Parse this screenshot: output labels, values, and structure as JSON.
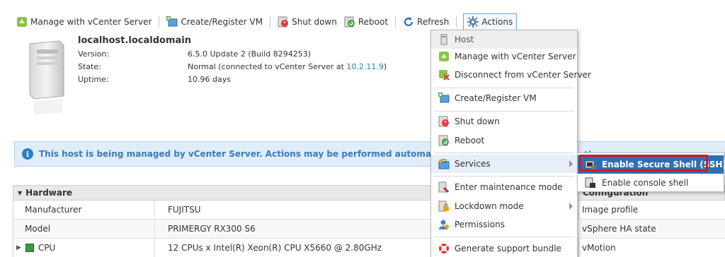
{
  "toolbar": {
    "manage": "Manage with vCenter Server",
    "create": "Create/Register VM",
    "shutdown": "Shut down",
    "reboot": "Reboot",
    "refresh": "Refresh",
    "actions": "Actions"
  },
  "host": {
    "name": "localhost.localdomain",
    "version_label": "Version:",
    "version_value": "6.5.0 Update 2 (Build 8294253)",
    "state_label": "State:",
    "state_value": "Normal (connected to vCenter Server at ",
    "state_ip": "10.2.11.9",
    "state_close": ")",
    "uptime_label": "Uptime:",
    "uptime_value": "10.96 days"
  },
  "banner": {
    "text": "This host is being managed by vCenter Server. Actions may be performed automatically by vCenter S"
  },
  "config_behind": "ctions",
  "hardware": {
    "title": "Hardware",
    "rows": [
      {
        "label": "Manufacturer",
        "value": "FUJITSU"
      },
      {
        "label": "Model",
        "value": "PRIMERGY RX300 S6"
      },
      {
        "label": "CPU",
        "value": "12 CPUs x Intel(R) Xeon(R) CPU X5660 @ 2.80GHz"
      }
    ]
  },
  "configuration": {
    "title": "Configuration",
    "rows": [
      "Image profile",
      "vSphere HA state",
      "vMotion"
    ]
  },
  "menu": {
    "header": "Host",
    "items": [
      "Manage with vCenter Server",
      "Disconnect from vCenter Server",
      "Create/Register VM",
      "Shut down",
      "Reboot",
      "Services",
      "Enter maintenance mode",
      "Lockdown mode",
      "Permissions",
      "Generate support bundle"
    ]
  },
  "submenu": {
    "items": [
      "Enable Secure Shell (SSH)",
      "Enable console shell"
    ]
  },
  "colors": {
    "accent": "#2e6fb0",
    "highlight": "#d9171c",
    "banner_bg": "#dfedf9"
  }
}
